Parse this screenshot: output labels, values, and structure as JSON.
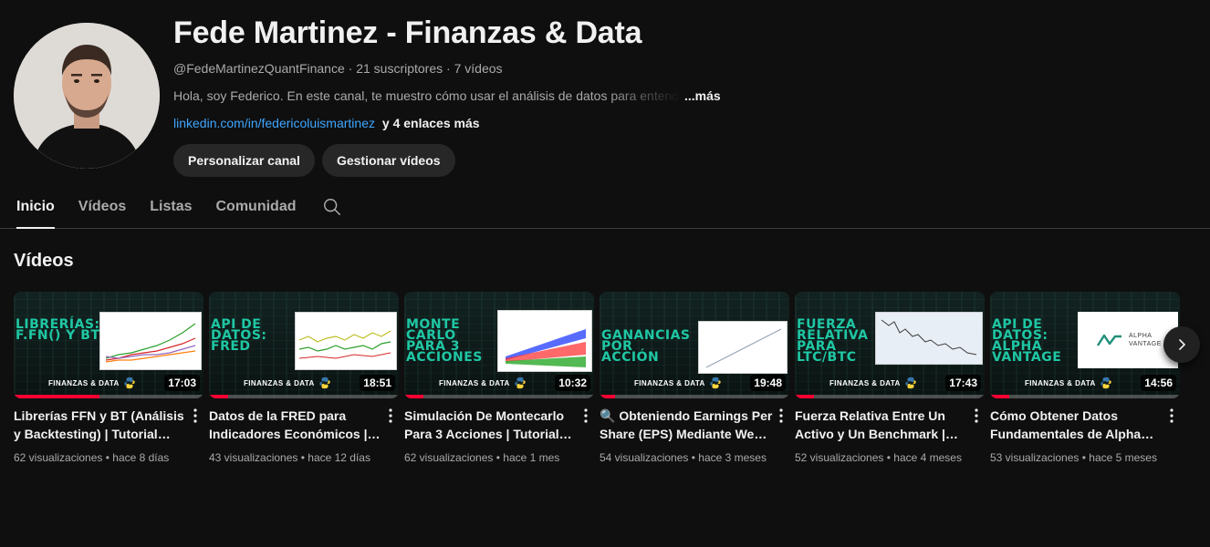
{
  "channel": {
    "name": "Fede Martinez - Finanzas & Data",
    "handle": "@FedeMartinezQuantFinance",
    "subscribers": "21 suscriptores",
    "video_count": "7 vídeos",
    "meta_separator": " · ",
    "description": "Hola, soy Federico. En este canal, te muestro cómo usar el análisis de datos para entender",
    "description_more": "...más",
    "link": "linkedin.com/in/federicoluismartinez",
    "more_links": "y 4 enlaces más",
    "avatar_icon": "avatar-photo"
  },
  "actions": {
    "customize": "Personalizar canal",
    "manage": "Gestionar vídeos"
  },
  "tabs": [
    {
      "label": "Inicio",
      "active": true
    },
    {
      "label": "Vídeos",
      "active": false
    },
    {
      "label": "Listas",
      "active": false
    },
    {
      "label": "Comunidad",
      "active": false
    }
  ],
  "section": {
    "title": "Vídeos"
  },
  "brand_label": "FINANZAS & DATA",
  "colors": {
    "accent_teal": "#1fc7a4",
    "progress_red": "#ff0033",
    "link_blue": "#3ea6ff"
  },
  "videos": [
    {
      "thumb_text": "LIBRERÍAS: F.FN() Y BT",
      "duration": "17:03",
      "progress": 0.45,
      "title": "Librerías FFN y BT (Análisis y Backtesting) | Tutorial Python",
      "views": "62 visualizaciones",
      "age": "hace 8 días"
    },
    {
      "thumb_text": "API DE DATOS: FRED",
      "duration": "18:51",
      "progress": 0.1,
      "title": "Datos de la FRED para Indicadores Económicos | Tutorial",
      "views": "43 visualizaciones",
      "age": "hace 12 días"
    },
    {
      "thumb_text": "MONTE CARLO PARA 3 ACCIONES",
      "duration": "10:32",
      "progress": 0.1,
      "title": "Simulación De Montecarlo Para 3 Acciones | Tutorial Python",
      "views": "62 visualizaciones",
      "age": "hace 1 mes"
    },
    {
      "thumb_text": "GANANCIAS POR ACCIÓN",
      "duration": "19:48",
      "progress": 0.08,
      "title": "🔍 Obteniendo Earnings Per Share (EPS) Mediante Web Scraping",
      "views": "54 visualizaciones",
      "age": "hace 3 meses"
    },
    {
      "thumb_text": "FUERZA RELATIVA PARA LTC/BTC",
      "duration": "17:43",
      "progress": 0.1,
      "title": "Fuerza Relativa Entre Un Activo y Un Benchmark | Tutorial",
      "views": "52 visualizaciones",
      "age": "hace 4 meses"
    },
    {
      "thumb_text": "API DE DATOS: ALPHA VANTAGE",
      "duration": "14:56",
      "progress": 0.1,
      "title": "Cómo Obtener Datos Fundamentales de Alpha Vantage",
      "views": "53 visualizaciones",
      "age": "hace 5 meses",
      "logo_text": [
        "ALPHA",
        "VANTAGE"
      ]
    }
  ]
}
